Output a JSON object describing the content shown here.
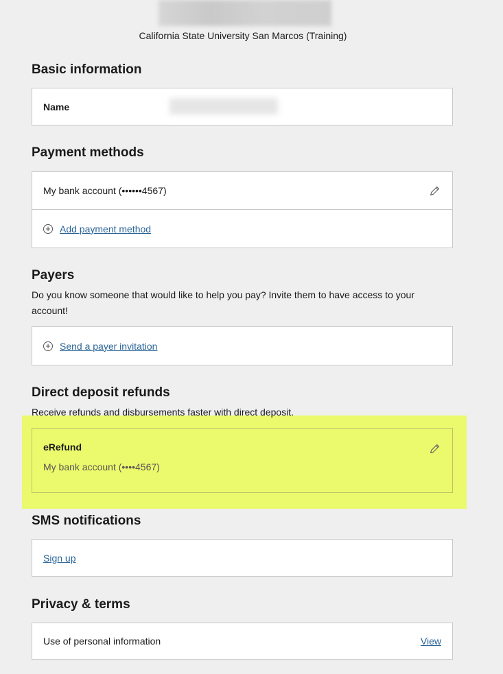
{
  "header": {
    "university": "California State University San Marcos (Training)"
  },
  "basic_info": {
    "title": "Basic information",
    "name_label": "Name"
  },
  "payment_methods": {
    "title": "Payment methods",
    "account": "My bank account (••••••4567)",
    "add_label": "Add payment method"
  },
  "payers": {
    "title": "Payers",
    "description": "Do you know someone that would like to help you pay? Invite them to have access to your account!",
    "invite_label": "Send a payer invitation"
  },
  "direct_deposit": {
    "title": "Direct deposit refunds",
    "description": "Receive refunds and disbursements faster with direct deposit.",
    "method_title": "eRefund",
    "method_account": "My bank account (••••4567)",
    "highlight_color": "#eaf95d"
  },
  "sms": {
    "title": "SMS notifications",
    "signup_label": "Sign up"
  },
  "privacy": {
    "title": "Privacy & terms",
    "item_label": "Use of personal information",
    "view_label": "View"
  },
  "colors": {
    "link": "#2a6496",
    "background": "#efefef",
    "card_border": "#c8c8c8"
  },
  "icons": {
    "edit": "pencil-icon",
    "add": "plus-circle-icon"
  }
}
